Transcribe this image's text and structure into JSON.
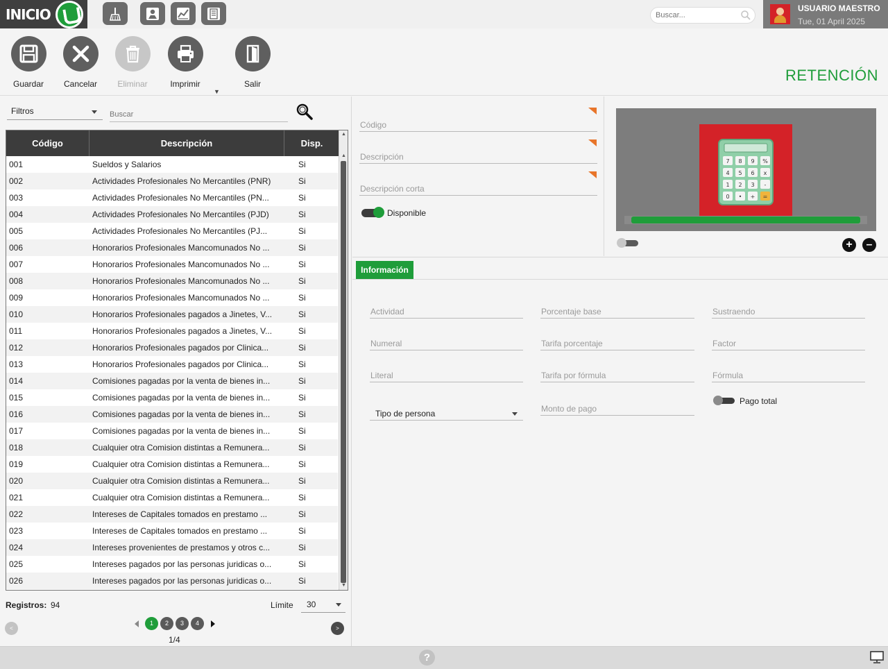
{
  "header": {
    "logo_text": "INICIO",
    "search_placeholder": "Buscar...",
    "user_name": "USUARIO MAESTRO",
    "user_date": "Tue, 01 April 2025"
  },
  "toolbar": {
    "save_label": "Guardar",
    "cancel_label": "Cancelar",
    "delete_label": "Eliminar",
    "print_label": "Imprimir",
    "exit_label": "Salir"
  },
  "page_title": "RETENCIÓN",
  "list": {
    "filter_label": "Filtros",
    "search_placeholder": "Buscar",
    "columns": [
      "Código",
      "Descripción",
      "Disp."
    ],
    "rows": [
      {
        "code": "001",
        "desc": "Sueldos y Salarios",
        "disp": "Si"
      },
      {
        "code": "002",
        "desc": "Actividades Profesionales No Mercantiles (PNR)",
        "disp": "Si"
      },
      {
        "code": "003",
        "desc": "Actividades Profesionales No Mercantiles (PN...",
        "disp": "Si"
      },
      {
        "code": "004",
        "desc": "Actividades Profesionales No Mercantiles (PJD)",
        "disp": "Si"
      },
      {
        "code": "005",
        "desc": "Actividades Profesionales No Mercantiles (PJ...",
        "disp": "Si"
      },
      {
        "code": "006",
        "desc": "Honorarios Profesionales Mancomunados No ...",
        "disp": "Si"
      },
      {
        "code": "007",
        "desc": "Honorarios Profesionales Mancomunados No ...",
        "disp": "Si"
      },
      {
        "code": "008",
        "desc": "Honorarios Profesionales Mancomunados No ...",
        "disp": "Si"
      },
      {
        "code": "009",
        "desc": "Honorarios Profesionales Mancomunados No ...",
        "disp": "Si"
      },
      {
        "code": "010",
        "desc": "Honorarios Profesionales pagados a Jinetes, V...",
        "disp": "Si"
      },
      {
        "code": "011",
        "desc": "Honorarios Profesionales pagados a Jinetes, V...",
        "disp": "Si"
      },
      {
        "code": "012",
        "desc": "Honorarios Profesionales pagados por Clinica...",
        "disp": "Si"
      },
      {
        "code": "013",
        "desc": "Honorarios Profesionales pagados por Clinica...",
        "disp": "Si"
      },
      {
        "code": "014",
        "desc": "Comisiones pagadas por la venta de bienes in...",
        "disp": "Si"
      },
      {
        "code": "015",
        "desc": "Comisiones pagadas por la venta de bienes in...",
        "disp": "Si"
      },
      {
        "code": "016",
        "desc": "Comisiones pagadas por la venta de bienes in...",
        "disp": "Si"
      },
      {
        "code": "017",
        "desc": "Comisiones pagadas por la venta de bienes in...",
        "disp": "Si"
      },
      {
        "code": "018",
        "desc": "Cualquier otra Comision distintas a Remunera...",
        "disp": "Si"
      },
      {
        "code": "019",
        "desc": "Cualquier otra Comision distintas a Remunera...",
        "disp": "Si"
      },
      {
        "code": "020",
        "desc": "Cualquier otra Comision distintas a Remunera...",
        "disp": "Si"
      },
      {
        "code": "021",
        "desc": "Cualquier otra Comision distintas a Remunera...",
        "disp": "Si"
      },
      {
        "code": "022",
        "desc": "Intereses de Capitales tomados en prestamo ...",
        "disp": "Si"
      },
      {
        "code": "023",
        "desc": "Intereses de Capitales tomados en prestamo ...",
        "disp": "Si"
      },
      {
        "code": "024",
        "desc": "Intereses provenientes de prestamos y otros c...",
        "disp": "Si"
      },
      {
        "code": "025",
        "desc": "Intereses pagados por las personas juridicas o...",
        "disp": "Si"
      },
      {
        "code": "026",
        "desc": "Intereses pagados por las personas juridicas o...",
        "disp": "Si"
      }
    ],
    "records_label": "Registros:",
    "records_value": "94",
    "limit_label": "Límite",
    "limit_value": "30",
    "pages": [
      "1",
      "2",
      "3",
      "4"
    ],
    "prev_glyph": "<",
    "next_glyph": ">",
    "page_count": "1/4"
  },
  "form": {
    "codigo": "Código",
    "descripcion": "Descripción",
    "descripcion_corta": "Descripción corta",
    "disponible": "Disponible"
  },
  "image": {
    "calc_keys": [
      "7",
      "8",
      "9",
      "%",
      "4",
      "5",
      "6",
      "x",
      "1",
      "2",
      "3",
      "-",
      "0",
      "•",
      "+",
      "="
    ]
  },
  "tabs": [
    {
      "label": "Información"
    }
  ],
  "details": {
    "actividad": "Actividad",
    "porcentaje_base": "Porcentaje base",
    "sustraendo": "Sustraendo",
    "numeral": "Numeral",
    "tarifa_porcentaje": "Tarifa porcentaje",
    "factor": "Factor",
    "literal": "Literal",
    "tarifa_formula": "Tarifa por fórmula",
    "formula": "Fórmula",
    "tipo_persona": "Tipo de persona",
    "monto_pago": "Monto de pago",
    "pago_total": "Pago total"
  },
  "footer": {
    "help_glyph": "?"
  },
  "colors": {
    "accent": "#1f9d3a",
    "dark": "#3c3c3c",
    "required_flag": "#e8752a",
    "user_avatar": "#d42228"
  },
  "icons": [
    "menu-broom-icon",
    "map-pin-icon",
    "chart-report-icon",
    "calculator-doc-icon",
    "search-icon",
    "save-icon",
    "close-icon",
    "trash-icon",
    "printer-icon",
    "door-exit-icon",
    "monitor-icon",
    "help-icon"
  ]
}
